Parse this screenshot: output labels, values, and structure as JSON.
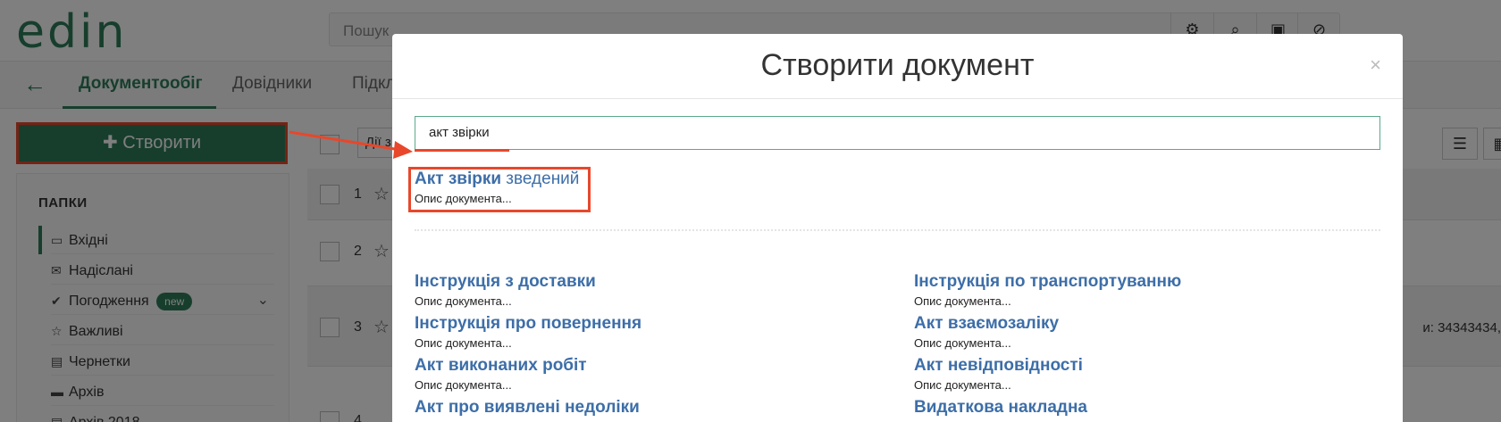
{
  "app": {
    "logo": "edin"
  },
  "search": {
    "placeholder": "Пошук"
  },
  "toolbar_icons": [
    "sliders-icon",
    "search-icon",
    "save-icon",
    "ban-icon"
  ],
  "nav": {
    "back": "←",
    "tabs": [
      "Документообіг",
      "Довідники",
      "Підкл"
    ]
  },
  "create_button": "Створити",
  "sidebar": {
    "title": "ПАПКИ",
    "items": [
      {
        "label": "Вхідні",
        "icon": "inbox-icon"
      },
      {
        "label": "Надіслані",
        "icon": "envelope-icon"
      },
      {
        "label": "Погодження",
        "icon": "check-icon",
        "badge": "new"
      },
      {
        "label": "Важливі",
        "icon": "star-icon"
      },
      {
        "label": "Чернетки",
        "icon": "file-icon"
      },
      {
        "label": "Архів",
        "icon": "archive-icon"
      },
      {
        "label": "Архів 2018",
        "icon": "file-icon"
      }
    ]
  },
  "list": {
    "actions_label": "Дії з",
    "rows": [
      {
        "num": "1"
      },
      {
        "num": "2"
      },
      {
        "num": "3",
        "side_text": "и: 34343434,"
      },
      {
        "num": "4"
      }
    ]
  },
  "modal": {
    "title": "Створити документ",
    "close": "×",
    "search_value": "акт звірки",
    "featured": {
      "name_bold": "Акт звірки",
      "name_rest": " зведений",
      "desc": "Опис документа..."
    },
    "left_docs": [
      {
        "name": "Інструкція з доставки",
        "desc": "Опис документа..."
      },
      {
        "name": "Інструкція про повернення",
        "desc": "Опис документа..."
      },
      {
        "name": "Акт виконаних робіт",
        "desc": "Опис документа..."
      },
      {
        "name": "Акт про виявлені недоліки",
        "desc": ""
      }
    ],
    "right_docs": [
      {
        "name": "Інструкція по транспортуванню",
        "desc": "Опис документа..."
      },
      {
        "name": "Акт взаємозаліку",
        "desc": "Опис документа..."
      },
      {
        "name": "Акт невідповідності",
        "desc": "Опис документа..."
      },
      {
        "name": "Видаткова накладна",
        "desc": ""
      }
    ]
  },
  "colors": {
    "brand": "#2e7d5b",
    "highlight": "#e8472b",
    "link": "#3d6ea8"
  }
}
